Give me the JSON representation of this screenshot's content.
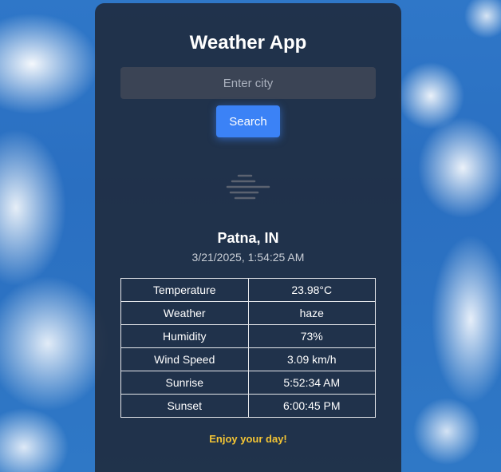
{
  "app": {
    "title": "Weather App",
    "search_placeholder": "Enter city",
    "search_label": "Search"
  },
  "current": {
    "icon": "haze-icon",
    "location": "Patna, IN",
    "datetime": "3/21/2025, 1:54:25 AM"
  },
  "details": [
    {
      "label": "Temperature",
      "value": "23.98°C"
    },
    {
      "label": "Weather",
      "value": "haze"
    },
    {
      "label": "Humidity",
      "value": "73%"
    },
    {
      "label": "Wind Speed",
      "value": "3.09 km/h"
    },
    {
      "label": "Sunrise",
      "value": "5:52:34 AM"
    },
    {
      "label": "Sunset",
      "value": "6:00:45 PM"
    }
  ],
  "footer": {
    "message": "Enjoy your day!"
  },
  "colors": {
    "accent": "#3b82f6",
    "footer_text": "#f4c534",
    "card_bg": "#1f293a"
  }
}
